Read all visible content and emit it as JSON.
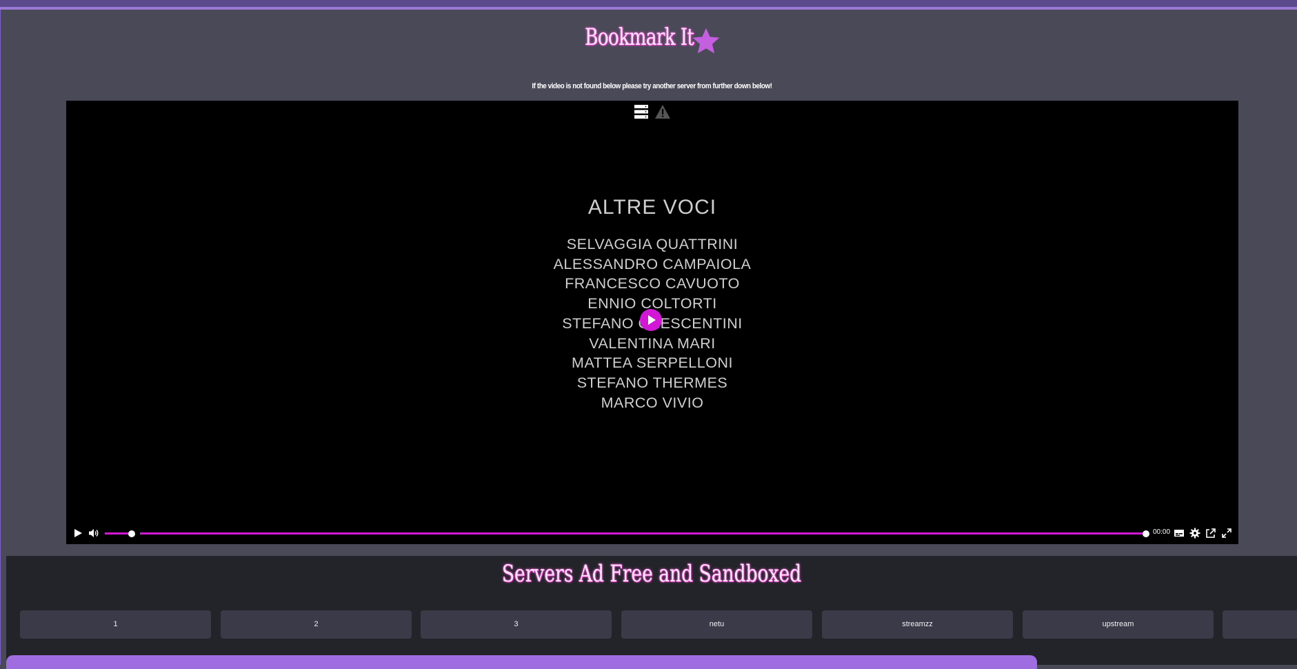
{
  "header": {
    "title": "Bookmark It",
    "notice": "If the video is not found below please try another server from further down below!"
  },
  "player": {
    "credits": {
      "heading": "ALTRE VOCI",
      "names": [
        "SELVAGGIA QUATTRINI",
        "ALESSANDRO CAMPAIOLA",
        "FRANCESCO CAVUOTO",
        "ENNIO COLTORTI",
        "STEFANO CRESCENTINI",
        "VALENTINA MARI",
        "MATTEA SERPELLONI",
        "STEFANO THERMES",
        "MARCO VIVIO"
      ]
    },
    "controls": {
      "time": "00:00"
    },
    "colors": {
      "accent": "#d317d7"
    },
    "icons": [
      "server-list-icon",
      "warning-icon",
      "play-icon",
      "volume-icon",
      "subtitles-icon",
      "settings-icon",
      "popout-icon",
      "fullscreen-icon"
    ]
  },
  "servers": {
    "title": "Servers Ad Free and Sandboxed",
    "buttons": [
      "1",
      "2",
      "3",
      "netu",
      "streamzz",
      "upstream",
      ""
    ]
  }
}
